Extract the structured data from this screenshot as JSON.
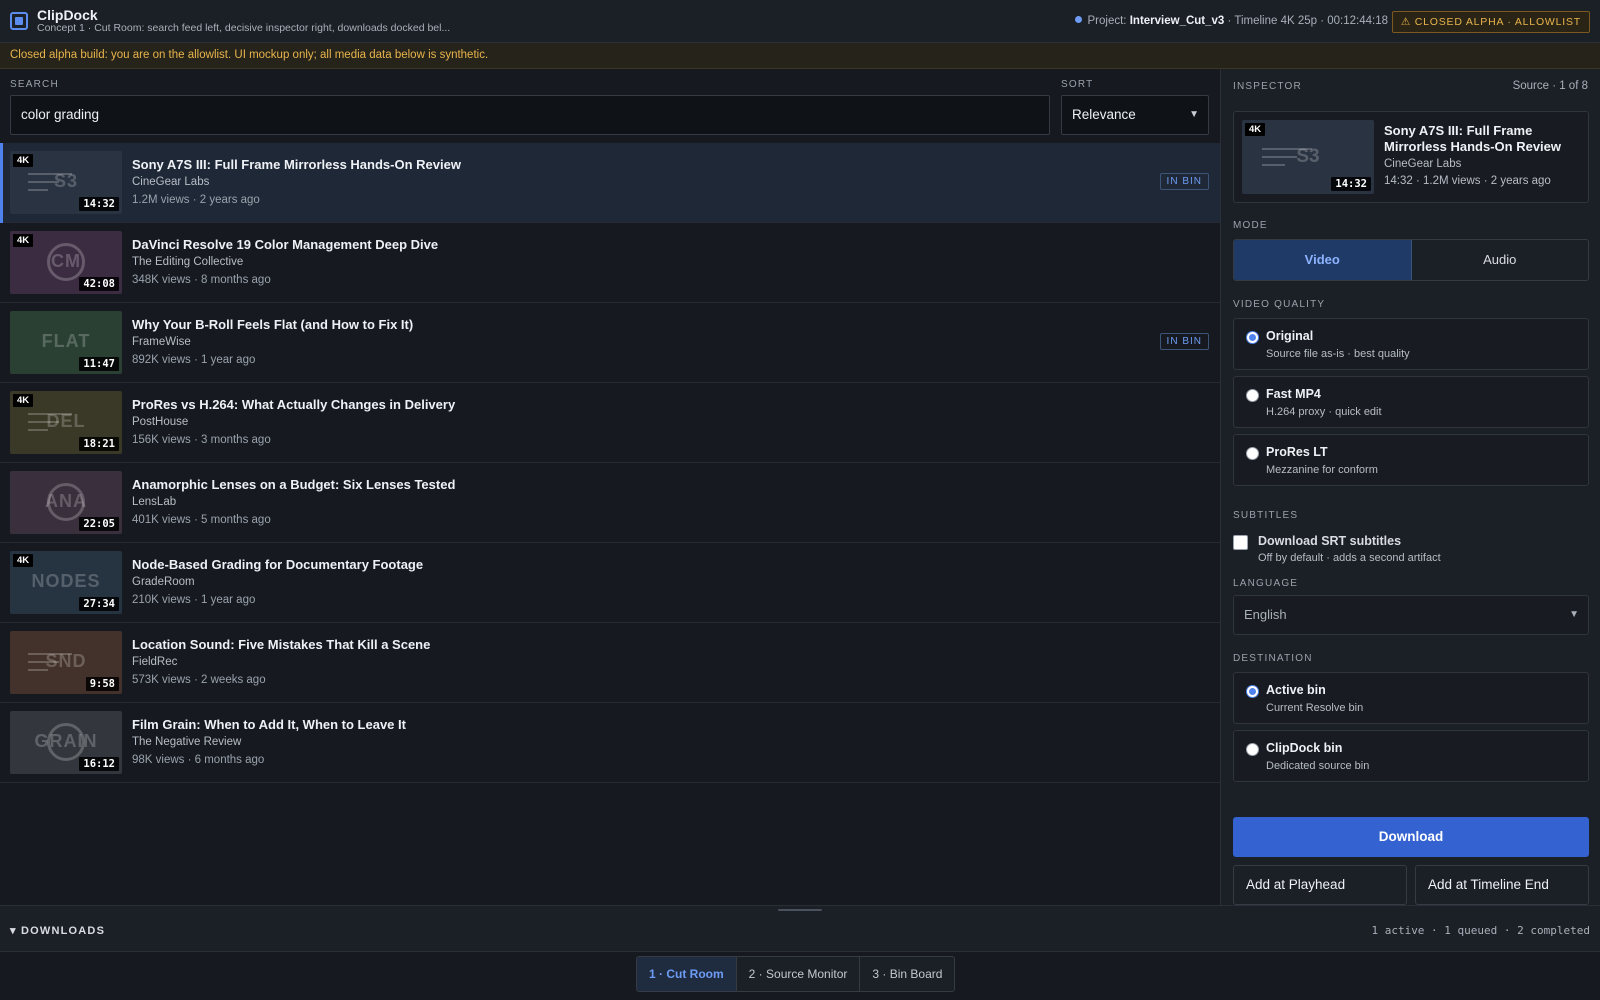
{
  "header": {
    "app_name": "ClipDock",
    "subtitle": "Concept 1 · Cut Room: search feed left, decisive inspector right, downloads docked bel...",
    "project_label": "Project:",
    "project_name": "Interview_Cut_v3",
    "timeline": "· Timeline 4K 25p · 00:12:44:18",
    "alpha_badge": "⚠ CLOSED ALPHA · ALLOWLIST",
    "accent": "#5b8df0"
  },
  "banner": {
    "text": "Closed alpha build: you are on the allowlist. UI mockup only; all media data below is synthetic."
  },
  "search": {
    "label": "SEARCH",
    "value": "color grading",
    "sort_label": "SORT",
    "sort_value": "Relevance"
  },
  "results": [
    {
      "title": "Sony A7S III: Full Frame Mirrorless Hands-On Review",
      "channel": "CineGear Labs",
      "meta": "1.2M views · 2 years ago",
      "duration": "14:32",
      "is4k": true,
      "mark": "S3",
      "art": "lines",
      "bg": "#2a3342",
      "in_bin": "IN BIN",
      "selected": true
    },
    {
      "title": "DaVinci Resolve 19 Color Management Deep Dive",
      "channel": "The Editing Collective",
      "meta": "348K views · 8 months ago",
      "duration": "42:08",
      "is4k": true,
      "mark": "CM",
      "art": "ring",
      "bg": "#3b2c42",
      "in_bin": "",
      "selected": false
    },
    {
      "title": "Why Your B-Roll Feels Flat (and How to Fix It)",
      "channel": "FrameWise",
      "meta": "892K views · 1 year ago",
      "duration": "11:47",
      "is4k": false,
      "mark": "FLAT",
      "art": "plain",
      "bg": "#2a4032",
      "in_bin": "IN BIN",
      "selected": false
    },
    {
      "title": "ProRes vs H.264: What Actually Changes in Delivery",
      "channel": "PostHouse",
      "meta": "156K views · 3 months ago",
      "duration": "18:21",
      "is4k": true,
      "mark": "DEL",
      "art": "lines",
      "bg": "#3a3826",
      "in_bin": "",
      "selected": false
    },
    {
      "title": "Anamorphic Lenses on a Budget: Six Lenses Tested",
      "channel": "LensLab",
      "meta": "401K views · 5 months ago",
      "duration": "22:05",
      "is4k": false,
      "mark": "ANA",
      "art": "ring",
      "bg": "#3a2f3d",
      "in_bin": "",
      "selected": false
    },
    {
      "title": "Node-Based Grading for Documentary Footage",
      "channel": "GradeRoom",
      "meta": "210K views · 1 year ago",
      "duration": "27:34",
      "is4k": true,
      "mark": "NODES",
      "art": "plain",
      "bg": "#263442",
      "in_bin": "",
      "selected": false
    },
    {
      "title": "Location Sound: Five Mistakes That Kill a Scene",
      "channel": "FieldRec",
      "meta": "573K views · 2 weeks ago",
      "duration": "9:58",
      "is4k": false,
      "mark": "SND",
      "art": "lines",
      "bg": "#43322b",
      "in_bin": "",
      "selected": false
    },
    {
      "title": "Film Grain: When to Add It, When to Leave It",
      "channel": "The Negative Review",
      "meta": "98K views · 6 months ago",
      "duration": "16:12",
      "is4k": false,
      "mark": "GRAIN",
      "art": "ring",
      "bg": "#33373d",
      "in_bin": "",
      "selected": false
    }
  ],
  "inspector": {
    "label": "INSPECTOR",
    "source": "Source · 1 of 8",
    "title": "Sony A7S III: Full Frame Mirrorless Hands-On Review",
    "channel": "CineGear Labs",
    "meta": "14:32 · 1.2M views · 2 years ago",
    "duration": "14:32",
    "badge": "4K",
    "mark": "S3",
    "mode_label": "MODE",
    "mode_video": "Video",
    "mode_audio": "Audio",
    "quality_label": "VIDEO QUALITY",
    "quality_options": [
      {
        "title": "Original",
        "sub": "Source file as-is · best quality",
        "selected": true
      },
      {
        "title": "Fast MP4",
        "sub": "H.264 proxy · quick edit",
        "selected": false
      },
      {
        "title": "ProRes LT",
        "sub": "Mezzanine for conform",
        "selected": false
      }
    ],
    "subtitles_label": "SUBTITLES",
    "subtitles_check": "Download SRT subtitles",
    "subtitles_note": "Off by default · adds a second artifact",
    "language_label": "LANGUAGE",
    "language_value": "English",
    "destination_label": "DESTINATION",
    "destination_options": [
      {
        "title": "Active bin",
        "sub": "Current Resolve bin",
        "selected": true
      },
      {
        "title": "ClipDock bin",
        "sub": "Dedicated source bin",
        "selected": false
      }
    ],
    "download_button": "Download",
    "add_playhead_button": "Add at Playhead",
    "add_end_button": "Add at Timeline End"
  },
  "downloads": {
    "title": "▾ DOWNLOADS",
    "status": "1 active · 1 queued · 2 completed"
  },
  "tabs": [
    {
      "label": "1 · Cut Room",
      "active": true
    },
    {
      "label": "2 · Source Monitor",
      "active": false
    },
    {
      "label": "3 · Bin Board",
      "active": false
    }
  ]
}
